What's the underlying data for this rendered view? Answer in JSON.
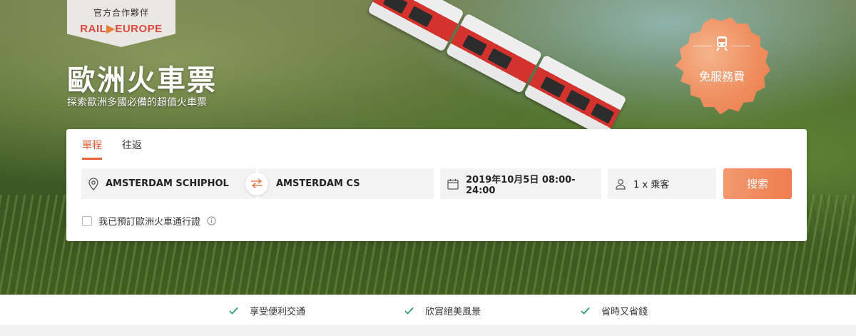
{
  "partner": {
    "title": "官方合作夥伴",
    "logo_rail": "RAIL",
    "logo_europe": "EUROPE"
  },
  "hero": {
    "title": "歐洲火車票",
    "subtitle": "探索歐洲多國必備的超值火車票"
  },
  "badge": {
    "text": "免服務費",
    "icon": "train-icon"
  },
  "tabs": [
    {
      "label": "單程",
      "active": true
    },
    {
      "label": "往返",
      "active": false
    }
  ],
  "search": {
    "from": "AMSTERDAM SCHIPHOL",
    "to": "AMSTERDAM CS",
    "date": "2019年10月5日 08:00-24:00",
    "passengers": "1 x 乘客",
    "button_label": "搜索",
    "pass_checkbox_label": "我已預訂歐洲火車通行證",
    "pass_checked": false
  },
  "benefits": [
    {
      "label": "享受便利交通"
    },
    {
      "label": "欣賞絕美風景"
    },
    {
      "label": "省時又省錢"
    }
  ],
  "colors": {
    "accent": "#e8603c",
    "button": "#ef7d50",
    "badge": "#ef8e60"
  }
}
